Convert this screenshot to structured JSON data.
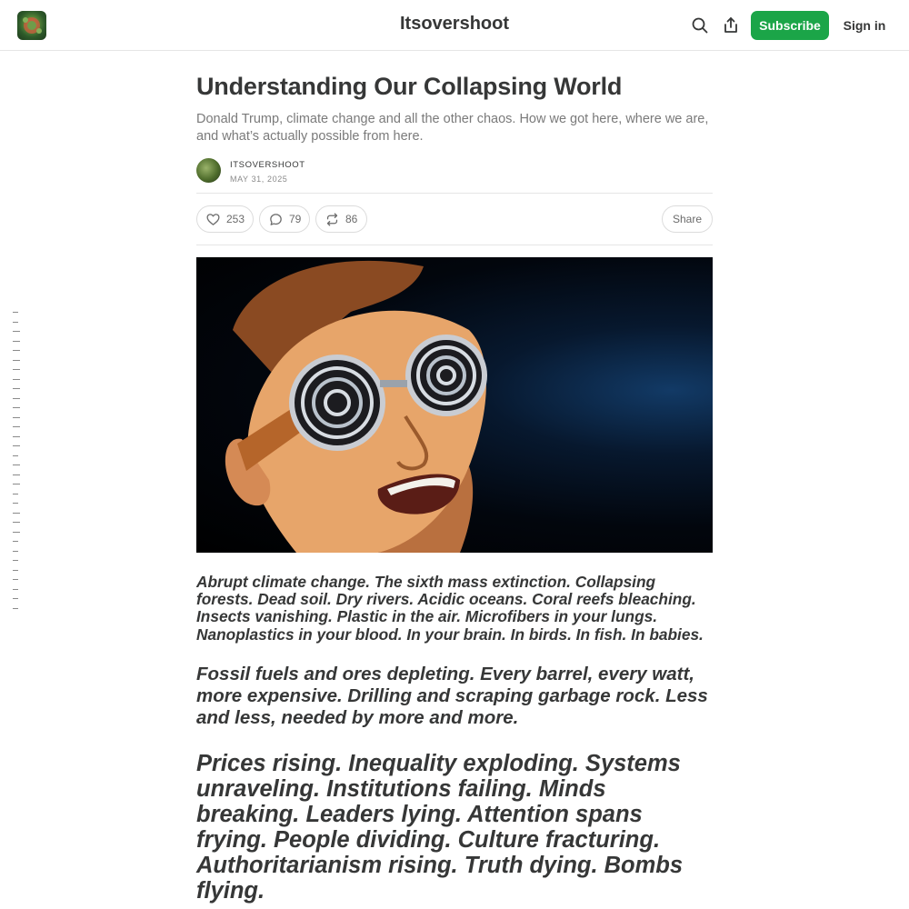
{
  "header": {
    "site_title": "Itsovershoot",
    "subscribe_label": "Subscribe",
    "signin_label": "Sign in",
    "icons": [
      "search-icon",
      "share-icon"
    ],
    "accent_color": "#1ba548"
  },
  "post": {
    "title": "Understanding Our Collapsing World",
    "subtitle": "Donald Trump, climate change and all the other chaos. How we got here, where we are, and what’s actually possible from here.",
    "author": "ITSOVERSHOOT",
    "date": "MAY 31, 2025"
  },
  "actions": {
    "likes": "253",
    "comments": "79",
    "restacks": "86",
    "share_label": "Share"
  },
  "body": {
    "p1": "Abrupt climate change. The sixth mass extinction. Collapsing forests. Dead soil. Dry rivers. Acidic oceans. Coral reefs bleaching. Insects vanishing. Plastic in the air. Microfibers in your lungs. Nanoplastics in your blood. In your brain. In birds. In fish. In babies.",
    "p2": "Fossil fuels and ores depleting. Every barrel, every watt, more expensive. Drilling and scraping garbage rock. Less and less, needed by more and more.",
    "p3": "Prices rising. Inequality exploding. Systems unraveling. Institutions failing. Minds breaking. Leaders lying. Attention spans frying. People dividing. Culture fracturing. Authoritarianism rising. Truth dying. Bombs flying."
  }
}
